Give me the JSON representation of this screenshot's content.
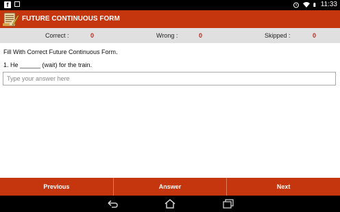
{
  "status_bar": {
    "time": "11:33",
    "icons": [
      "facebook-icon",
      "image-icon",
      "alarm-icon",
      "wifi-icon",
      "battery-icon"
    ]
  },
  "action_bar": {
    "title": "FUTURE CONTINUOUS FORM",
    "colors": {
      "accent": "#c6360e"
    }
  },
  "score": {
    "correct_label": "Correct :",
    "correct_value": "0",
    "wrong_label": "Wrong :",
    "wrong_value": "0",
    "skipped_label": "Skipped :",
    "skipped_value": "0",
    "value_color": "#d41f0e"
  },
  "content": {
    "instruction": "Fill With Correct Future Continuous Form.",
    "question": "1. He ______ (wait) for the train.",
    "answer_placeholder": "Type your answer here",
    "answer_value": ""
  },
  "bottom_bar": {
    "previous_label": "Previous",
    "answer_label": "Answer",
    "next_label": "Next"
  },
  "nav_bar": {
    "icons": [
      "back-icon",
      "home-icon",
      "recents-icon"
    ]
  }
}
